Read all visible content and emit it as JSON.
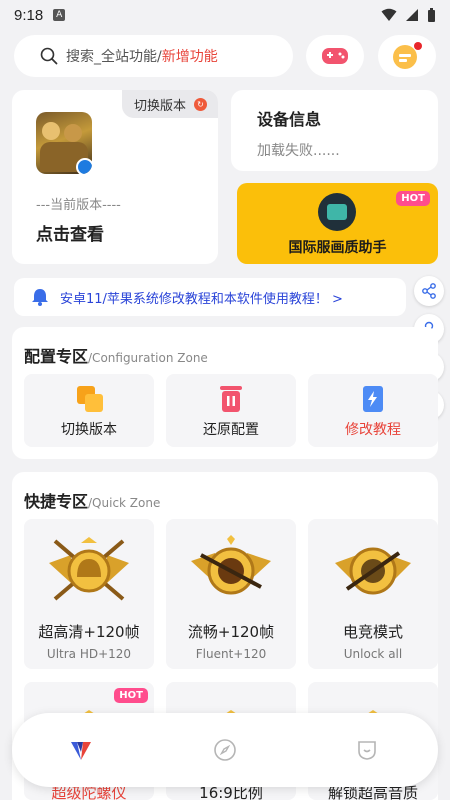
{
  "status_bar": {
    "time": "9:18",
    "badge": "A"
  },
  "search": {
    "placeholder_main": "搜索_全站功能/",
    "placeholder_highlight": "新增功能"
  },
  "version_card": {
    "switch_label": "切换版本",
    "current_version_label": "---当前版本----",
    "view_label": "点击查看"
  },
  "device_card": {
    "title": "设备信息",
    "status": "加载失败......"
  },
  "intl_card": {
    "hot": "HOT",
    "label": "国际服画质助手"
  },
  "notice": {
    "text": "安卓11/苹果系统修改教程和本软件使用教程！ >"
  },
  "config_zone": {
    "title": "配置专区",
    "subtitle": "/Configuration Zone",
    "items": [
      {
        "label": "切换版本",
        "icon": "switch-icon"
      },
      {
        "label": "还原配置",
        "icon": "restore-icon"
      },
      {
        "label": "修改教程",
        "icon": "tutorial-icon",
        "color": "#e8443a"
      }
    ]
  },
  "quick_zone": {
    "title": "快捷专区",
    "subtitle": "/Quick Zone",
    "items": [
      {
        "label": "超高清+120帧",
        "sub": "Ultra HD+120"
      },
      {
        "label": "流畅+120帧",
        "sub": "Fluent+120"
      },
      {
        "label": "电竞模式",
        "sub": "Unlock all"
      }
    ],
    "items_row2": [
      {
        "label": "超级陀螺仪",
        "hot": "HOT",
        "color": "#e8443a"
      },
      {
        "label": "16:9比例"
      },
      {
        "label": "解锁超高音质"
      }
    ]
  },
  "bottom_nav": {
    "items": [
      "home-icon",
      "compass-icon",
      "profile-icon"
    ]
  },
  "colors": {
    "accent": "#fbbf0a",
    "hot": "#ff4d8d",
    "link": "#2a44d8",
    "red": "#e8443a"
  }
}
